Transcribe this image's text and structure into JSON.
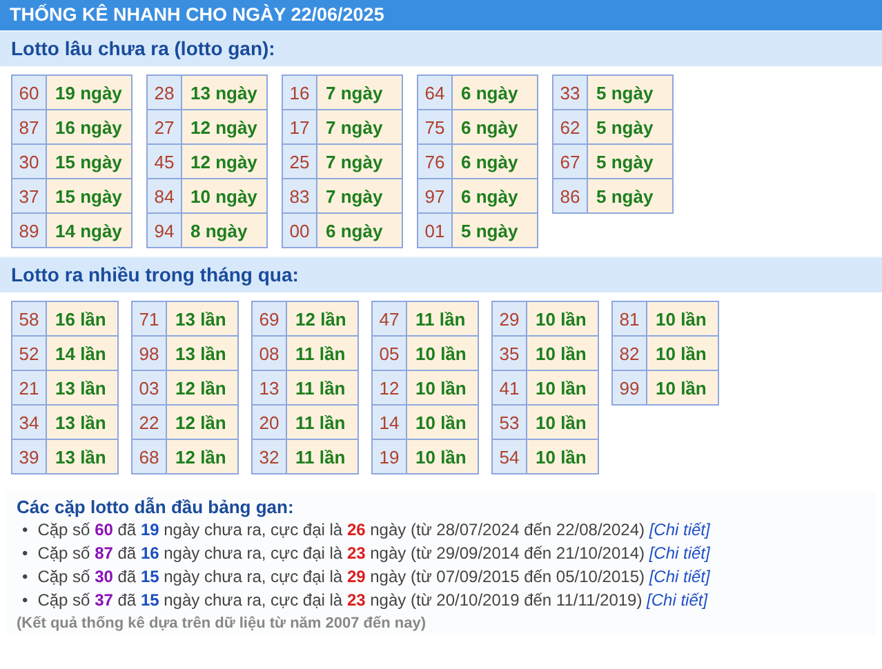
{
  "title": "THỐNG KÊ NHANH CHO NGÀY 22/06/2025",
  "sections": [
    {
      "heading": "Lotto lâu chưa ra (lotto gan):",
      "kind": "gan",
      "tables": [
        [
          [
            "60",
            "19 ngày"
          ],
          [
            "87",
            "16 ngày"
          ],
          [
            "30",
            "15 ngày"
          ],
          [
            "37",
            "15 ngày"
          ],
          [
            "89",
            "14 ngày"
          ]
        ],
        [
          [
            "28",
            "13 ngày"
          ],
          [
            "27",
            "12 ngày"
          ],
          [
            "45",
            "12 ngày"
          ],
          [
            "84",
            "10 ngày"
          ],
          [
            "94",
            "8 ngày"
          ]
        ],
        [
          [
            "16",
            "7 ngày"
          ],
          [
            "17",
            "7 ngày"
          ],
          [
            "25",
            "7 ngày"
          ],
          [
            "83",
            "7 ngày"
          ],
          [
            "00",
            "6 ngày"
          ]
        ],
        [
          [
            "64",
            "6 ngày"
          ],
          [
            "75",
            "6 ngày"
          ],
          [
            "76",
            "6 ngày"
          ],
          [
            "97",
            "6 ngày"
          ],
          [
            "01",
            "5 ngày"
          ]
        ],
        [
          [
            "33",
            "5 ngày"
          ],
          [
            "62",
            "5 ngày"
          ],
          [
            "67",
            "5 ngày"
          ],
          [
            "86",
            "5 ngày"
          ]
        ]
      ]
    },
    {
      "heading": "Lotto ra nhiều trong tháng qua:",
      "kind": "nhieu",
      "tables": [
        [
          [
            "58",
            "16 lần"
          ],
          [
            "52",
            "14 lần"
          ],
          [
            "21",
            "13 lần"
          ],
          [
            "34",
            "13 lần"
          ],
          [
            "39",
            "13 lần"
          ]
        ],
        [
          [
            "71",
            "13 lần"
          ],
          [
            "98",
            "13 lần"
          ],
          [
            "03",
            "12 lần"
          ],
          [
            "22",
            "12 lần"
          ],
          [
            "68",
            "12 lần"
          ]
        ],
        [
          [
            "69",
            "12 lần"
          ],
          [
            "08",
            "11 lần"
          ],
          [
            "13",
            "11 lần"
          ],
          [
            "20",
            "11 lần"
          ],
          [
            "32",
            "11 lần"
          ]
        ],
        [
          [
            "47",
            "11 lần"
          ],
          [
            "05",
            "10 lần"
          ],
          [
            "12",
            "10 lần"
          ],
          [
            "14",
            "10 lần"
          ],
          [
            "19",
            "10 lần"
          ]
        ],
        [
          [
            "29",
            "10 lần"
          ],
          [
            "35",
            "10 lần"
          ],
          [
            "41",
            "10 lần"
          ],
          [
            "53",
            "10 lần"
          ],
          [
            "54",
            "10 lần"
          ]
        ],
        [
          [
            "81",
            "10 lần"
          ],
          [
            "82",
            "10 lần"
          ],
          [
            "99",
            "10 lần"
          ]
        ]
      ]
    }
  ],
  "leaders": {
    "heading": "Các cặp lotto dẫn đầu bảng gan:",
    "items": [
      {
        "bullet": "•",
        "parts": [
          {
            "kind": "plain",
            "text": "Cặp số "
          },
          {
            "kind": "pair",
            "text": "60"
          },
          {
            "kind": "plain",
            "text": " đã "
          },
          {
            "kind": "days",
            "text": "19"
          },
          {
            "kind": "plain",
            "text": " ngày chưa ra, cực đại là "
          },
          {
            "kind": "max",
            "text": "26"
          },
          {
            "kind": "plain",
            "text": " ngày (từ 28/07/2024 đến 22/08/2024) "
          }
        ],
        "link": "[Chi tiết]"
      },
      {
        "bullet": "•",
        "parts": [
          {
            "kind": "plain",
            "text": "Cặp số "
          },
          {
            "kind": "pair",
            "text": "87"
          },
          {
            "kind": "plain",
            "text": " đã "
          },
          {
            "kind": "days",
            "text": "16"
          },
          {
            "kind": "plain",
            "text": " ngày chưa ra, cực đại là "
          },
          {
            "kind": "max",
            "text": "23"
          },
          {
            "kind": "plain",
            "text": " ngày (từ 29/09/2014 đến 21/10/2014) "
          }
        ],
        "link": "[Chi tiết]"
      },
      {
        "bullet": "•",
        "parts": [
          {
            "kind": "plain",
            "text": "Cặp số "
          },
          {
            "kind": "pair",
            "text": "30"
          },
          {
            "kind": "plain",
            "text": " đã "
          },
          {
            "kind": "days",
            "text": "15"
          },
          {
            "kind": "plain",
            "text": " ngày chưa ra, cực đại là "
          },
          {
            "kind": "max",
            "text": "29"
          },
          {
            "kind": "plain",
            "text": " ngày (từ 07/09/2015 đến 05/10/2015) "
          }
        ],
        "link": "[Chi tiết]"
      },
      {
        "bullet": "•",
        "parts": [
          {
            "kind": "plain",
            "text": "Cặp số "
          },
          {
            "kind": "pair",
            "text": "37"
          },
          {
            "kind": "plain",
            "text": " đã "
          },
          {
            "kind": "days",
            "text": "15"
          },
          {
            "kind": "plain",
            "text": " ngày chưa ra, cực đại là "
          },
          {
            "kind": "max",
            "text": "23"
          },
          {
            "kind": "plain",
            "text": " ngày (từ 20/10/2019 đến 11/11/2019) "
          }
        ],
        "link": "[Chi tiết]"
      }
    ],
    "note": "(Kết quả thống kê dựa trên dữ liệu từ năm 2007 đến nay)"
  }
}
